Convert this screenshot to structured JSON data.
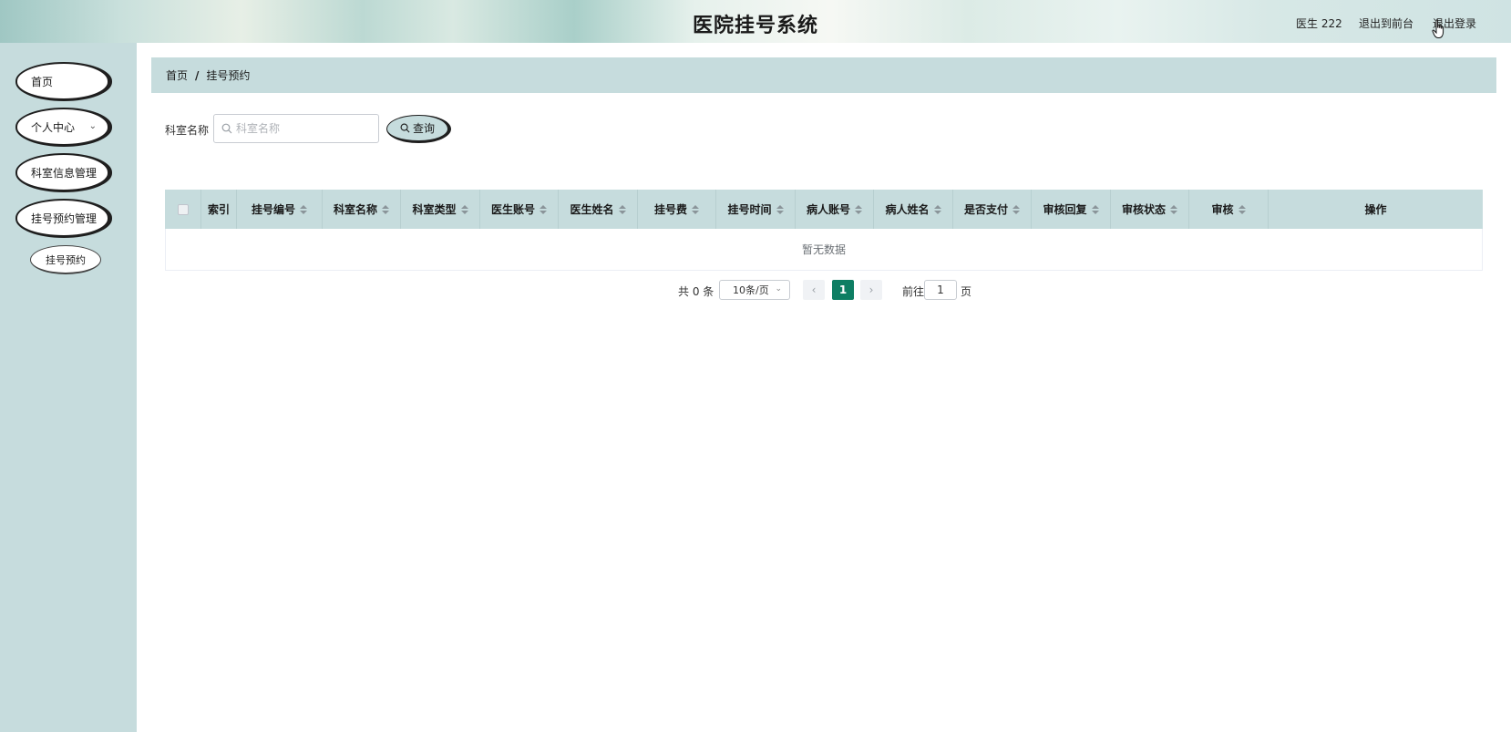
{
  "header": {
    "title": "医院挂号系统",
    "user": "医生 222",
    "front_link": "退出到前台",
    "logout_link": "退出登录"
  },
  "sidebar": {
    "items": [
      {
        "label": "首页"
      },
      {
        "label": "个人中心"
      },
      {
        "label": "科室信息管理"
      },
      {
        "label": "挂号预约管理"
      }
    ],
    "sub_items": [
      {
        "label": "挂号预约"
      }
    ]
  },
  "breadcrumb": {
    "home": "首页",
    "separator": "/",
    "current": "挂号预约"
  },
  "search": {
    "label": "科室名称",
    "placeholder": "科室名称",
    "button": "查询"
  },
  "table": {
    "columns": [
      "索引",
      "挂号编号",
      "科室名称",
      "科室类型",
      "医生账号",
      "医生姓名",
      "挂号费",
      "挂号时间",
      "病人账号",
      "病人姓名",
      "是否支付",
      "审核回复",
      "审核状态",
      "审核",
      "操作"
    ],
    "empty_text": "暂无数据"
  },
  "pagination": {
    "total": "共 0 条",
    "page_size": "10条/页",
    "current_page": "1",
    "goto_label": "前往",
    "goto_value": "1",
    "page_suffix": "页"
  },
  "colors": {
    "accent": "#c6dcdd",
    "active_page": "#0e7e63"
  }
}
